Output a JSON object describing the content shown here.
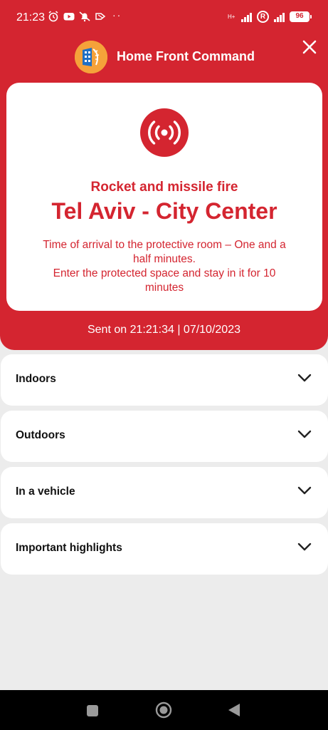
{
  "status_bar": {
    "time": "21:23",
    "network_label": "H+",
    "roaming_badge": "R",
    "battery": "96"
  },
  "header": {
    "title": "Home Front Command"
  },
  "alert": {
    "type": "Rocket and missile fire",
    "location": "Tel Aviv - City Center",
    "instructions_line1": "Time of arrival to the protective room – One and a half minutes.",
    "instructions_line2": "Enter the protected space and stay in it for 10 minutes",
    "sent_on": "Sent on 21:21:34 | 07/10/2023"
  },
  "sections": [
    {
      "label": "Indoors"
    },
    {
      "label": "Outdoors"
    },
    {
      "label": "In a vehicle"
    },
    {
      "label": "Important highlights"
    }
  ],
  "colors": {
    "accent_red": "#d42530",
    "background": "#ececec"
  },
  "icons": {
    "alert": "broadcast-signal-icon",
    "close": "close-icon",
    "chevron": "chevron-down-icon",
    "nav": [
      "recents-square-icon",
      "home-circle-icon",
      "back-triangle-icon"
    ]
  }
}
